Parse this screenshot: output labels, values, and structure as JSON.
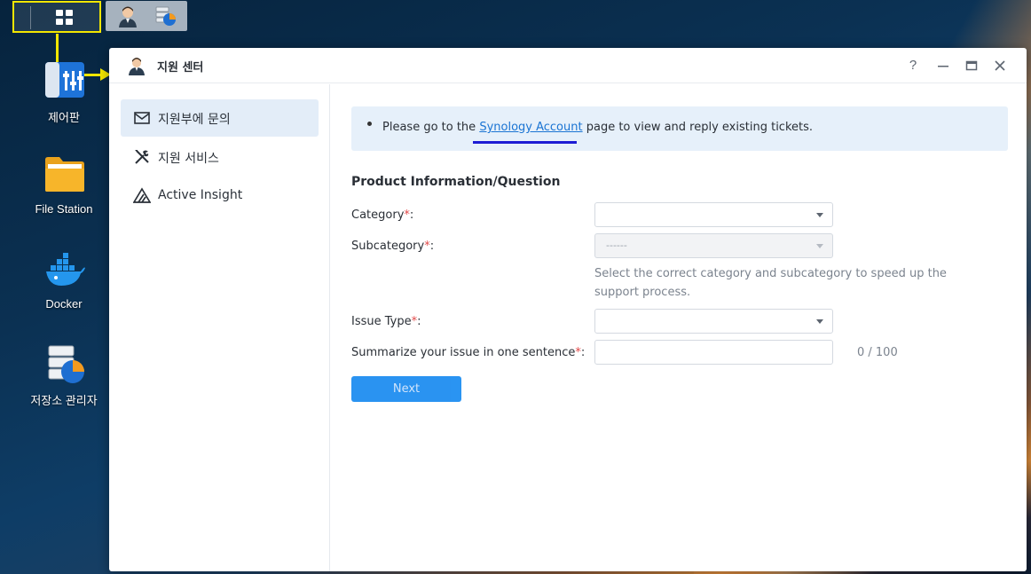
{
  "desktop": {
    "icons": [
      {
        "label": "제어판"
      },
      {
        "label": "File Station"
      },
      {
        "label": "Docker"
      },
      {
        "label": "저장소 관리자"
      }
    ]
  },
  "window": {
    "title": "지원 센터",
    "controls": {
      "help": "?"
    }
  },
  "sidebar": {
    "items": [
      {
        "label": "지원부에 문의",
        "active": true
      },
      {
        "label": "지원 서비스"
      },
      {
        "label": "Active Insight"
      }
    ]
  },
  "notice": {
    "prefix": "Please go to the ",
    "link": "Synology Account",
    "suffix": " page to view and reply existing tickets."
  },
  "form": {
    "section_title": "Product Information/Question",
    "category_label": "Category",
    "subcategory_label": "Subcategory",
    "subcategory_value": "------",
    "hint": "Select the correct category and subcategory to speed up the support process.",
    "issue_type_label": "Issue Type",
    "summary_label": "Summarize your issue in one sentence",
    "label_suffix": ":",
    "required_mark": "*",
    "counter": "0 / 100",
    "next_label": "Next"
  },
  "colors": {
    "accent": "#1f8ef1",
    "link": "#1a74d3",
    "required": "#e24a4a",
    "annotation": "#f2e600",
    "link_highlight": "#1d1cd4"
  }
}
